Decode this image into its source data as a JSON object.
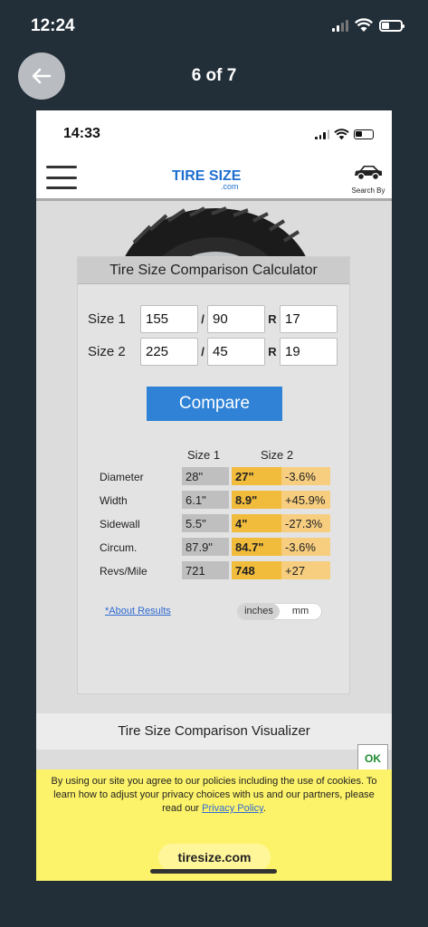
{
  "os_status": {
    "time": "12:24"
  },
  "viewer": {
    "page_counter": "6 of 7"
  },
  "screenshot": {
    "status": {
      "time": "14:33"
    },
    "header": {
      "logo_main": "TIRE SIZE",
      "logo_sub": ".com",
      "search_by_label": "Search By"
    },
    "calculator": {
      "title": "Tire Size Comparison Calculator",
      "size1": {
        "label": "Size 1",
        "width": "155",
        "ratio": "90",
        "rim": "17"
      },
      "size2": {
        "label": "Size 2",
        "width": "225",
        "ratio": "45",
        "rim": "19"
      },
      "slash": "/",
      "r_label": "R",
      "compare_label": "Compare",
      "results": {
        "col1": "Size 1",
        "col2": "Size 2",
        "rows": [
          {
            "label": "Diameter",
            "size1": "28\"",
            "size2": "27\"",
            "diff": "-3.6%"
          },
          {
            "label": "Width",
            "size1": "6.1\"",
            "size2": "8.9\"",
            "diff": "+45.9%"
          },
          {
            "label": "Sidewall",
            "size1": "5.5\"",
            "size2": "4\"",
            "diff": "-27.3%"
          },
          {
            "label": "Circum.",
            "size1": "87.9\"",
            "size2": "84.7\"",
            "diff": "-3.6%"
          },
          {
            "label": "Revs/Mile",
            "size1": "721",
            "size2": "748",
            "diff": "+27"
          }
        ]
      },
      "about_link": "*About Results",
      "units": {
        "inches": "inches",
        "mm": "mm",
        "selected": "inches"
      }
    },
    "visualizer_title": "Tire Size Comparison Visualizer",
    "cookie": {
      "ok_label": "OK",
      "text": "By using our site you agree to our policies including the use of cookies. To learn how to adjust your privacy choices with us and our partners, please read our ",
      "policy_link": "Privacy Policy",
      "period": ".",
      "site_label": "tiresize.com"
    }
  },
  "colors": {
    "background": "#222e38",
    "compare_button": "#2f82d6",
    "size2_cell": "#f1bb3c",
    "diff_cell": "#f7ce80",
    "size1_cell": "#bfbfbf",
    "cookie_banner": "#fdf36a"
  }
}
